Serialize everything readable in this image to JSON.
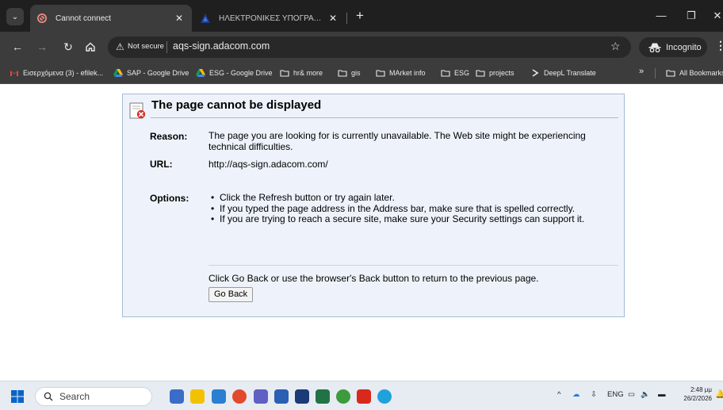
{
  "browser": {
    "tabs": [
      {
        "title": "Cannot connect",
        "active": true
      },
      {
        "title": "ΗΛΕΚΤΡΟΝΙΚΕΣ ΥΠΟΓΡΑΦΕΣ",
        "active": false
      }
    ],
    "security_label": "Not secure",
    "url": "aqs-sign.adacom.com",
    "incognito_label": "Incognito",
    "bookmarks": [
      {
        "label": "Εισερχόμενα (3) - efilek...",
        "icon": "gmail-icon"
      },
      {
        "label": "SAP - Google Drive",
        "icon": "google-drive-icon"
      },
      {
        "label": "ESG - Google Drive",
        "icon": "google-drive-icon"
      },
      {
        "label": "hr& more",
        "icon": "folder-icon"
      },
      {
        "label": "gis",
        "icon": "folder-icon"
      },
      {
        "label": "MArket info",
        "icon": "folder-icon"
      },
      {
        "label": "ESG",
        "icon": "folder-icon"
      },
      {
        "label": "projects",
        "icon": "folder-icon"
      },
      {
        "label": "DeepL Translate",
        "icon": "deepl-icon"
      }
    ],
    "bookmarks_overflow": "»",
    "all_bookmarks_label": "All Bookmarks"
  },
  "error_page": {
    "title": "The page cannot be displayed",
    "reason_label": "Reason:",
    "reason_text": "The page you are looking for is currently unavailable. The Web site might be experiencing technical difficulties.",
    "url_label": "URL:",
    "url_value": "http://aqs-sign.adacom.com/",
    "options_label": "Options:",
    "options": [
      "Click the Refresh button or try again later.",
      "If you typed the page address in the Address bar, make sure that is spelled correctly.",
      "If you are trying to reach a secure site, make sure your Security settings can support it."
    ],
    "back_text": "Click Go Back or use the browser's Back button to return to the previous page.",
    "go_back_label": "Go Back"
  },
  "taskbar": {
    "search_placeholder": "Search",
    "language": "ENG",
    "time": "2:48 μμ",
    "date": "26/2/2026"
  },
  "colors": {
    "tab_bar": "#1f1f1f",
    "toolbar": "#3c3c3c",
    "error_box_bg": "#eef3fb",
    "error_box_border": "#a5bcd6",
    "taskbar": "#e7ecf3"
  }
}
